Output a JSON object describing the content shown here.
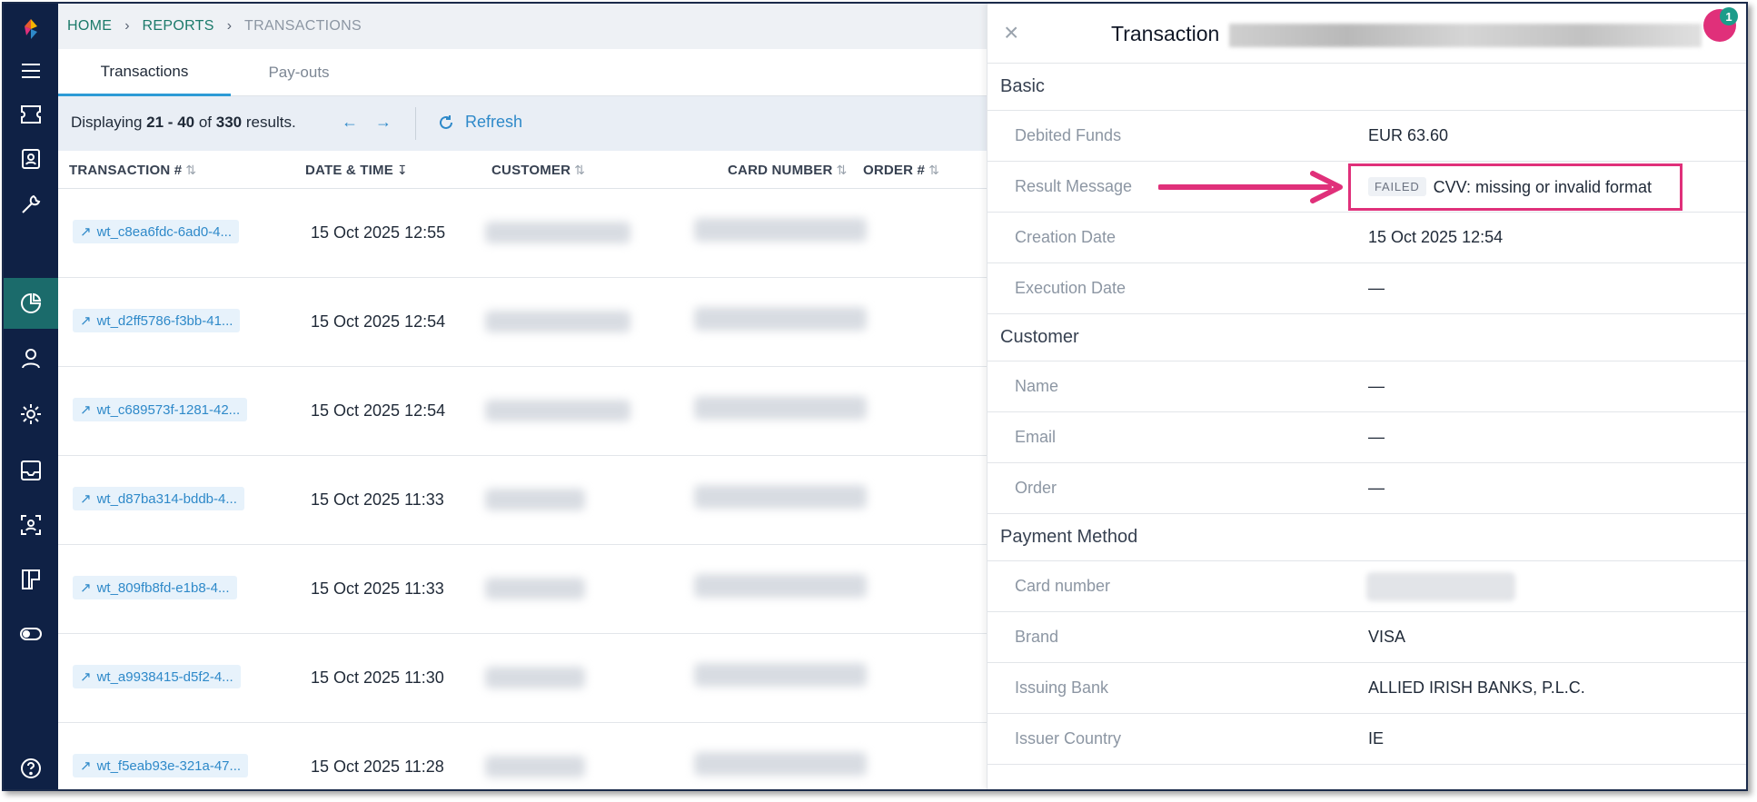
{
  "breadcrumb": [
    "HOME",
    "REPORTS",
    "TRANSACTIONS"
  ],
  "tabs": [
    {
      "label": "Transactions",
      "active": true
    },
    {
      "label": "Pay-outs",
      "active": false
    }
  ],
  "toolbar": {
    "displaying_prefix": "Displaying",
    "range": "21 - 40",
    "of_word": "of",
    "total": "330",
    "results_word": "results.",
    "prev_arrow": "←",
    "next_arrow": "→",
    "refresh_label": "Refresh"
  },
  "table": {
    "columns": [
      "TRANSACTION #",
      "DATE & TIME",
      "CUSTOMER",
      "CARD NUMBER",
      "ORDER #"
    ],
    "sort_column": "DATE & TIME",
    "sort_direction": "descending",
    "rows": [
      {
        "id": "wt_c8ea6fdc-6ad0-4...",
        "date": "15 Oct 2025 12:55"
      },
      {
        "id": "wt_d2ff5786-f3bb-41...",
        "date": "15 Oct 2025 12:54"
      },
      {
        "id": "wt_c689573f-1281-42...",
        "date": "15 Oct 2025 12:54"
      },
      {
        "id": "wt_d87ba314-bddb-4...",
        "date": "15 Oct 2025 11:33"
      },
      {
        "id": "wt_809fb8fd-e1b8-4...",
        "date": "15 Oct 2025 11:33"
      },
      {
        "id": "wt_a9938415-d5f2-4...",
        "date": "15 Oct 2025 11:30"
      },
      {
        "id": "wt_f5eab93e-321a-47...",
        "date": "15 Oct 2025 11:28"
      }
    ]
  },
  "panel": {
    "title": "Transaction",
    "notification_count": "1",
    "sections": {
      "basic": "Basic",
      "customer": "Customer",
      "payment_method": "Payment Method"
    },
    "basic": {
      "debited_funds_label": "Debited Funds",
      "debited_funds_value": "EUR 63.60",
      "result_message_label": "Result Message",
      "result_status": "FAILED",
      "result_message_value": "CVV: missing or invalid format",
      "creation_date_label": "Creation Date",
      "creation_date_value": "15 Oct 2025 12:54",
      "execution_date_label": "Execution Date",
      "execution_date_value": "—"
    },
    "customer": {
      "name_label": "Name",
      "name_value": "—",
      "email_label": "Email",
      "email_value": "—",
      "order_label": "Order",
      "order_value": "—"
    },
    "payment": {
      "card_number_label": "Card number",
      "brand_label": "Brand",
      "brand_value": "VISA",
      "issuing_bank_label": "Issuing Bank",
      "issuing_bank_value": "ALLIED IRISH BANKS, P.L.C.",
      "issuer_country_label": "Issuer Country",
      "issuer_country_value": "IE"
    }
  },
  "colors": {
    "sidebar": "#0f2145",
    "sidebar_active": "#1b6b6b",
    "accent": "#2e89c9",
    "annotation": "#e0307a"
  },
  "icons": [
    "logo-icon",
    "menu-icon",
    "ticket-icon",
    "contact-card-icon",
    "wrench-icon",
    "pie-chart-icon",
    "user-icon",
    "gear-icon",
    "inbox-icon",
    "face-scan-icon",
    "board-icon",
    "toggle-icon",
    "help-icon",
    "external-link-icon",
    "refresh-icon",
    "close-icon"
  ]
}
